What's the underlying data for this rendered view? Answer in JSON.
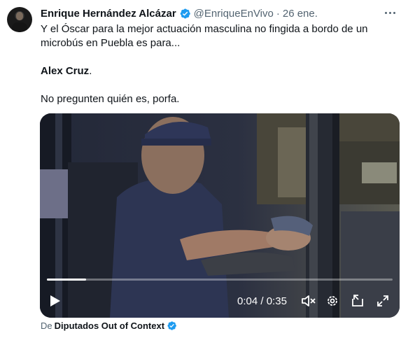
{
  "tweet": {
    "author_name": "Enrique Hernández Alcázar",
    "handle": "@EnriqueEnVivo",
    "separator": "·",
    "date": "26 ene.",
    "text_line_1": "Y el Óscar para la mejor actuación masculina no fingida a bordo de un",
    "text_line_2": "microbús en Puebla es para...",
    "text_bold": "Alex Cruz",
    "text_bold_suffix": ".",
    "text_line_4": "No pregunten quién es, porfa."
  },
  "video": {
    "current_time": "0:04",
    "time_separator": " / ",
    "duration": "0:35",
    "progress_fraction": 0.114
  },
  "source": {
    "prefix": "De",
    "account": "Diputados Out of Context"
  },
  "icons": [
    "more-icon",
    "verified-icon",
    "play-icon",
    "mute-icon",
    "settings-icon",
    "pip-icon",
    "fullscreen-icon"
  ],
  "colors": {
    "verified": "#1d9bf0",
    "secondary_text": "#536471",
    "primary_text": "#0f1419"
  }
}
